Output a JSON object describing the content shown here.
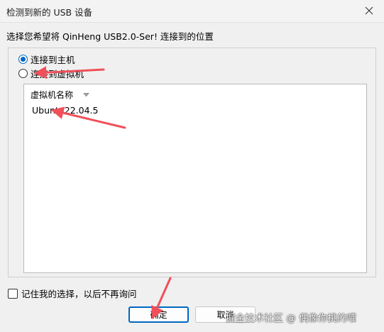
{
  "window": {
    "title": "检测到新的 USB 设备",
    "close_icon": "close-icon"
  },
  "dialog": {
    "prompt": "选择您希望将 QinHeng USB2.0-Ser! 连接到的位置",
    "options": [
      {
        "label": "连接到主机",
        "checked": true
      },
      {
        "label": "连接到虚拟机",
        "checked": false
      }
    ],
    "vm_list": {
      "column_header": "虚拟机名称",
      "sort_icon": "sort-down-icon",
      "rows": [
        "Ubuntu22.04.5"
      ]
    },
    "remember_label": "记住我的选择，以后不再询问",
    "remember_checked": false,
    "ok_label": "确定",
    "cancel_label": "取消"
  },
  "watermark": "掘金技术社区 @ 偶像你挑的嚯",
  "colors": {
    "accent": "#0067c0",
    "annotation_arrow": "#f0505a",
    "background": "#f0f0f0"
  }
}
